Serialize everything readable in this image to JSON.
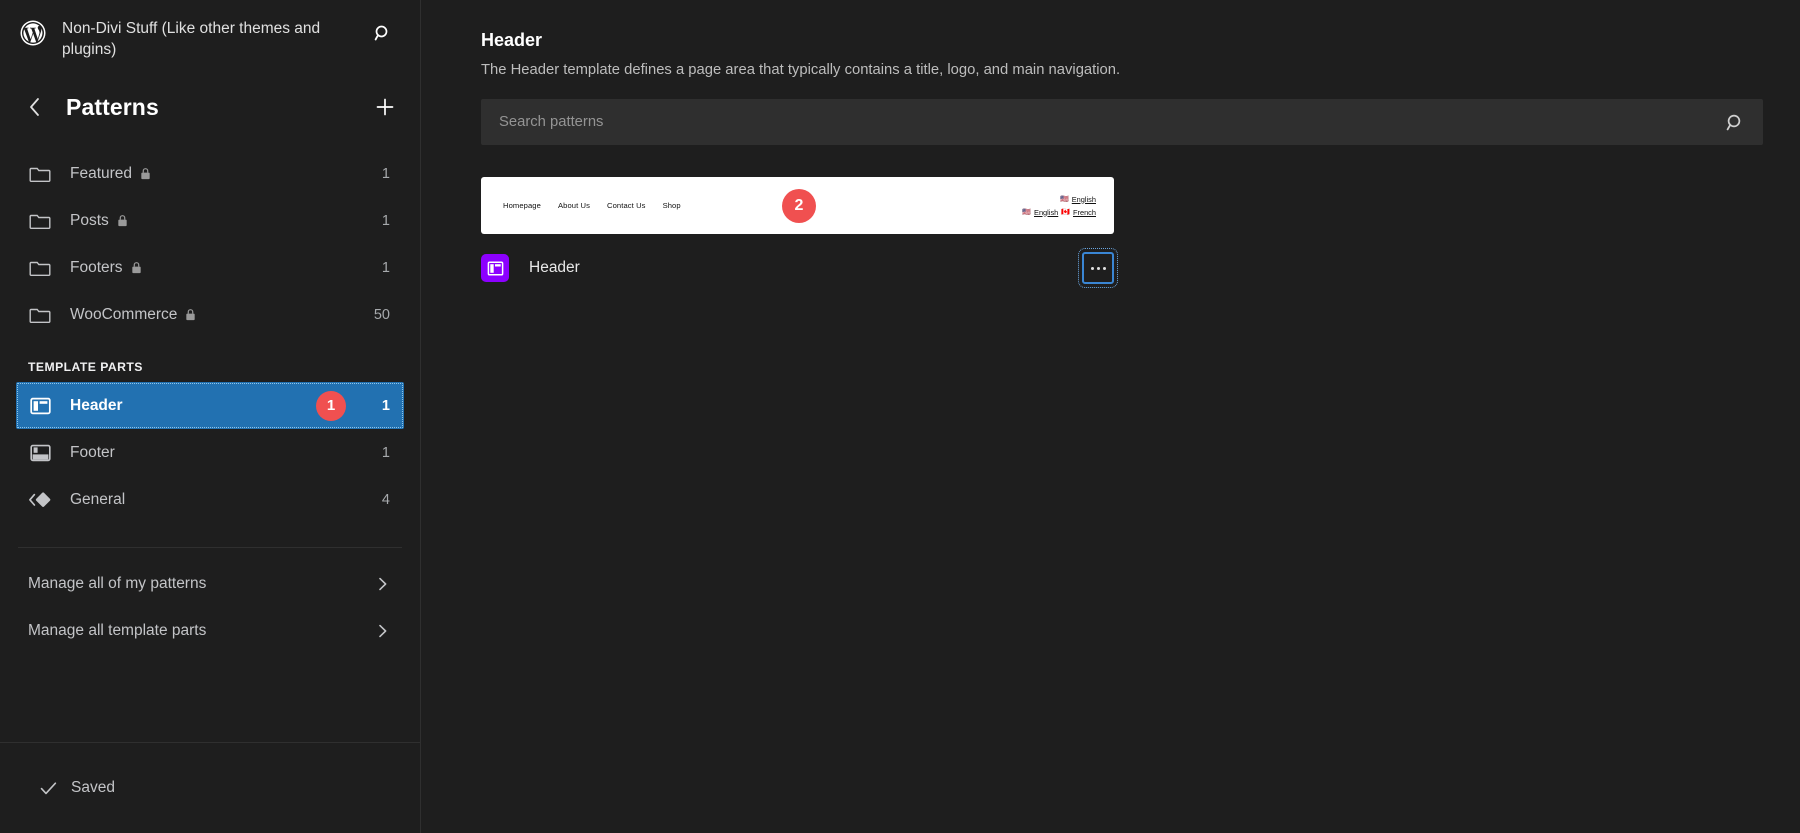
{
  "sidebar": {
    "site_title": "Non-Divi Stuff (Like other themes and plugins)",
    "search_icon": "search-icon",
    "logo_icon": "wordpress-logo-icon",
    "back_icon": "chevron-left-icon",
    "panel_title": "Patterns",
    "add_icon": "plus-icon",
    "categories": [
      {
        "label": "Featured",
        "count": "1",
        "icon": "folder-icon",
        "locked": true
      },
      {
        "label": "Posts",
        "count": "1",
        "icon": "folder-icon",
        "locked": true
      },
      {
        "label": "Footers",
        "count": "1",
        "icon": "folder-icon",
        "locked": true
      },
      {
        "label": "WooCommerce",
        "count": "50",
        "icon": "folder-icon",
        "locked": true
      }
    ],
    "template_parts_heading": "TEMPLATE PARTS",
    "template_parts": [
      {
        "label": "Header",
        "count": "1",
        "icon": "header-layout-icon",
        "selected": true,
        "badge": "1"
      },
      {
        "label": "Footer",
        "count": "1",
        "icon": "footer-layout-icon",
        "selected": false
      },
      {
        "label": "General",
        "count": "4",
        "icon": "pattern-diamond-icon",
        "selected": false
      }
    ],
    "manage_links": [
      {
        "label": "Manage all of my patterns",
        "icon": "chevron-right-icon"
      },
      {
        "label": "Manage all template parts",
        "icon": "chevron-right-icon"
      }
    ],
    "status": {
      "label": "Saved",
      "icon": "check-icon"
    }
  },
  "main": {
    "title": "Header",
    "description": "The Header template defines a page area that typically contains a title, logo, and main navigation.",
    "search": {
      "placeholder": "Search patterns",
      "value": "",
      "icon": "search-icon"
    },
    "preview": {
      "badge": "2",
      "nav_links": [
        "Homepage",
        "About Us",
        "Contact Us",
        "Shop"
      ],
      "language_rows": [
        {
          "items": [
            {
              "flag": "🇺🇸",
              "label": "English"
            }
          ]
        },
        {
          "items": [
            {
              "flag": "🇺🇸",
              "label": "English"
            },
            {
              "flag": "🇨🇦",
              "label": "French"
            }
          ]
        }
      ]
    },
    "item": {
      "name": "Header",
      "icon": "template-part-icon",
      "more_icon": "ellipsis-icon"
    }
  },
  "colors": {
    "accent_blue": "#2271b1",
    "badge_red": "#f05050",
    "icon_purple": "#8c00ff",
    "focus_blue": "#3a86d4",
    "background": "#1e1e1e"
  }
}
